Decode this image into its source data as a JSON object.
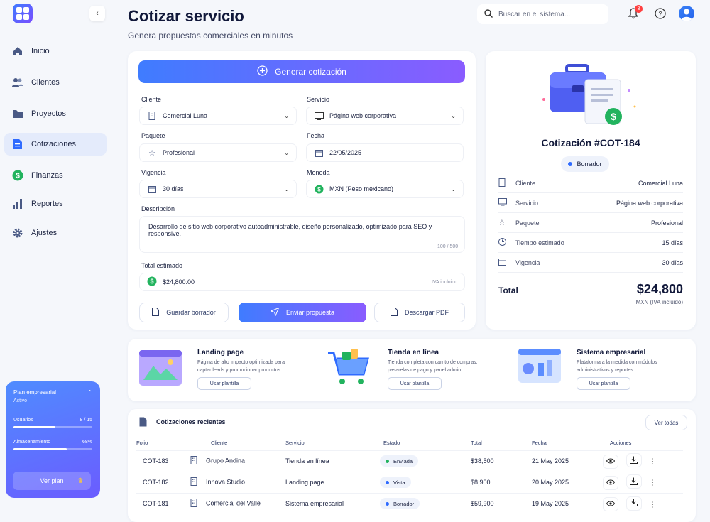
{
  "app": {
    "collapse_icon": "chevron-left-icon"
  },
  "nav": [
    {
      "label": "Inicio",
      "icon": "home-icon"
    },
    {
      "label": "Clientes",
      "icon": "users-icon"
    },
    {
      "label": "Proyectos",
      "icon": "folder-icon"
    },
    {
      "label": "Cotizaciones",
      "icon": "document-icon",
      "active": true
    },
    {
      "label": "Finanzas",
      "icon": "dollar-icon"
    },
    {
      "label": "Reportes",
      "icon": "bar-chart-icon"
    },
    {
      "label": "Ajustes",
      "icon": "gear-icon"
    }
  ],
  "plan": {
    "title": "Plan empresarial",
    "status": "Activo",
    "users_label": "Usuarios",
    "users_value": "8 / 15",
    "users_fraction": 0.53,
    "storage_label": "Almacenamiento",
    "storage_value": "68%",
    "storage_fraction": 0.68,
    "button": "Ver plan"
  },
  "header": {
    "title": "Cotizar servicio",
    "subtitle": "Genera propuestas comerciales en minutos",
    "search_placeholder": "Buscar en el sistema...",
    "notifications": "3"
  },
  "form": {
    "generate": "Generar cotización",
    "cliente_label": "Cliente",
    "cliente": "Comercial Luna",
    "servicio_label": "Servicio",
    "servicio": "Página web corporativa",
    "paquete_label": "Paquete",
    "paquete": "Profesional",
    "fecha_label": "Fecha",
    "fecha": "22/05/2025",
    "vigencia_label": "Vigencia",
    "vigencia": "30 días",
    "moneda_label": "Moneda",
    "moneda": "MXN (Peso mexicano)",
    "descripcion_label": "Descripción",
    "descripcion": "Desarrollo de sitio web corporativo autoadministrable, diseño personalizado, optimizado para SEO y responsive.",
    "char_count": "100 / 500",
    "total_label": "Total estimado",
    "total": "$24,800.00",
    "iva": "IVA incluido",
    "save_btn": "Guardar borrador",
    "send_btn": "Enviar propuesta",
    "pdf_btn": "Descargar PDF"
  },
  "summary": {
    "title": "Cotización #COT-184",
    "status": "Borrador",
    "rows": [
      {
        "label": "Cliente",
        "value": "Comercial Luna"
      },
      {
        "label": "Servicio",
        "value": "Página web corporativa"
      },
      {
        "label": "Paquete",
        "value": "Profesional"
      },
      {
        "label": "Tiempo estimado",
        "value": "15 días"
      },
      {
        "label": "Vigencia",
        "value": "30 días"
      }
    ],
    "total_label": "Total",
    "total": "$24,800",
    "total_note": "MXN (IVA incluido)"
  },
  "templates": [
    {
      "title": "Landing page",
      "desc": "Página de alto impacto optimizada para captar leads y promocionar productos.",
      "button": "Usar plantilla"
    },
    {
      "title": "Tienda en línea",
      "desc": "Tienda completa con carrito de compras, pasarelas de pago y panel admin.",
      "button": "Usar plantilla"
    },
    {
      "title": "Sistema empresarial",
      "desc": "Plataforma a la medida con módulos administrativos y reportes.",
      "button": "Usar plantilla"
    }
  ],
  "recent": {
    "title": "Cotizaciones recientes",
    "view_all": "Ver todas",
    "columns": [
      "Folio",
      "Cliente",
      "Servicio",
      "Estado",
      "Total",
      "Fecha",
      "Acciones"
    ],
    "rows": [
      {
        "folio": "COT-183",
        "cliente": "Grupo Andina",
        "servicio": "Tienda en línea",
        "estado": "Enviada",
        "estado_color": "#22b35e",
        "total": "$38,500",
        "fecha": "21 May 2025"
      },
      {
        "folio": "COT-182",
        "cliente": "Innova Studio",
        "servicio": "Landing page",
        "estado": "Vista",
        "estado_color": "#2f6bff",
        "total": "$8,900",
        "fecha": "20 May 2025"
      },
      {
        "folio": "COT-181",
        "cliente": "Comercial del Valle",
        "servicio": "Sistema empresarial",
        "estado": "Borrador",
        "estado_color": "#2f6bff",
        "total": "$59,900",
        "fecha": "19 May 2025"
      }
    ]
  },
  "colors": {
    "accent": "#3f7cff",
    "accent2": "#8a5cff",
    "green": "#22b35e"
  }
}
